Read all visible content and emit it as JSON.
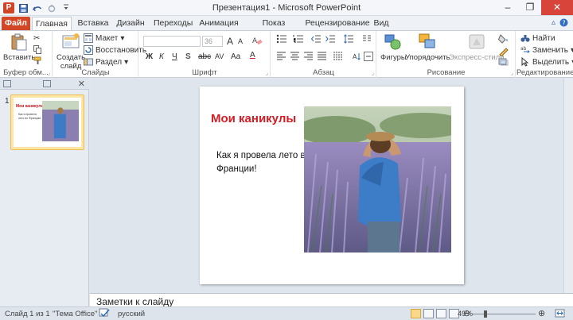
{
  "titlebar": {
    "title": "Презентация1 - Microsoft PowerPoint",
    "app_icon": "P",
    "qat_icons": [
      "save-icon",
      "undo-icon",
      "redo-icon",
      "customize-icon"
    ]
  },
  "tabs": [
    {
      "label": "Файл",
      "type": "file"
    },
    {
      "label": "Главная",
      "type": "active"
    },
    {
      "label": "Вставка"
    },
    {
      "label": "Дизайн"
    },
    {
      "label": "Переходы"
    },
    {
      "label": "Анимация"
    },
    {
      "label": "Показ слайдов"
    },
    {
      "label": "Рецензирование"
    },
    {
      "label": "Вид"
    }
  ],
  "ribbon": {
    "clipboard": {
      "paste": "Вставить",
      "label": "Буфер обм..."
    },
    "slides": {
      "create": "Создать",
      "create2": "слайд",
      "layout": "Макет",
      "reset": "Восстановить",
      "section": "Раздел",
      "label": "Слайды"
    },
    "font": {
      "size": "36",
      "label": "Шрифт",
      "bold": "Ж",
      "italic": "К",
      "underline": "Ч",
      "strike": "S",
      "shadow": "abc",
      "spacing": "AV",
      "case": "Aa",
      "color": "A",
      "grow": "A",
      "shrink": "A"
    },
    "paragraph": {
      "label": "Абзац"
    },
    "drawing": {
      "shapes": "Фигуры",
      "arrange": "Упорядочить",
      "styles": "Экспресс-стили",
      "label": "Рисование"
    },
    "editing": {
      "find": "Найти",
      "replace": "Заменить",
      "select": "Выделить",
      "label": "Редактирование"
    }
  },
  "slide_panel": {
    "number": "1"
  },
  "slide": {
    "title": "Мои каникулы",
    "body": "Как я провела лето во Франции!"
  },
  "notes": {
    "placeholder": "Заметки к слайду"
  },
  "status": {
    "slide": "Слайд 1 из 1",
    "theme": "\"Тема Office\"",
    "language": "русский",
    "zoom": "49%",
    "zoom_value": 0.49
  },
  "colors": {
    "file_tab": "#d24726",
    "title_red": "#d41c24",
    "thumb_highlight": "#fde5a6"
  }
}
